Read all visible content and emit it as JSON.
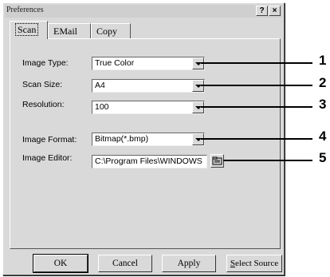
{
  "window": {
    "title": "Preferences",
    "help_label": "?",
    "close_label": "×"
  },
  "tabs": [
    {
      "label": "Scan",
      "active": true
    },
    {
      "label": "EMail",
      "active": false
    },
    {
      "label": "Copy",
      "active": false
    }
  ],
  "fields": {
    "image_type": {
      "label": "Image Type:",
      "value": "True Color"
    },
    "scan_size": {
      "label": "Scan Size:",
      "value": "A4"
    },
    "resolution": {
      "label": "Resolution:",
      "value": "100"
    },
    "image_format": {
      "label": "Image Format:",
      "value": "Bitmap(*.bmp)"
    },
    "image_editor": {
      "label": "Image Editor:",
      "value": "C:\\Program Files\\WINDOWS"
    }
  },
  "buttons": {
    "ok": "OK",
    "cancel": "Cancel",
    "apply": "Apply",
    "select_source_first": "S",
    "select_source_rest": "elect Source"
  },
  "callouts": [
    "1",
    "2",
    "3",
    "4",
    "5"
  ],
  "icons": {
    "browse": "folder-icon",
    "dropdown": "chevron-down-icon"
  }
}
